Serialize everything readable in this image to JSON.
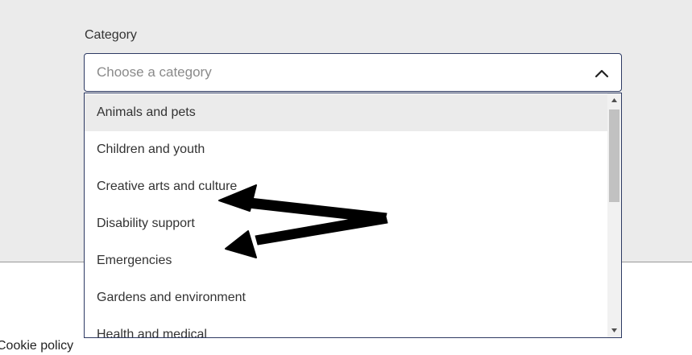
{
  "form": {
    "category_label": "Category",
    "category_placeholder": "Choose a category"
  },
  "dropdown": {
    "options": [
      {
        "label": "Animals and pets"
      },
      {
        "label": "Children and youth"
      },
      {
        "label": "Creative arts and culture"
      },
      {
        "label": "Disability support"
      },
      {
        "label": "Emergencies"
      },
      {
        "label": "Gardens and environment"
      },
      {
        "label": "Health and medical"
      }
    ],
    "highlighted_index": 0
  },
  "footer": {
    "cookie_link": "Cookie policy"
  },
  "icons": {
    "toggle": "chevron-up-icon",
    "scroll_up": "triangle-up-icon",
    "scroll_down": "triangle-down-icon",
    "annotation": "arrow-annotation-icon"
  },
  "colors": {
    "panel_background": "#ebebeb",
    "select_border": "#2d3a63",
    "highlight_row": "#ebebeb",
    "annotation_arrow": "#000000"
  }
}
